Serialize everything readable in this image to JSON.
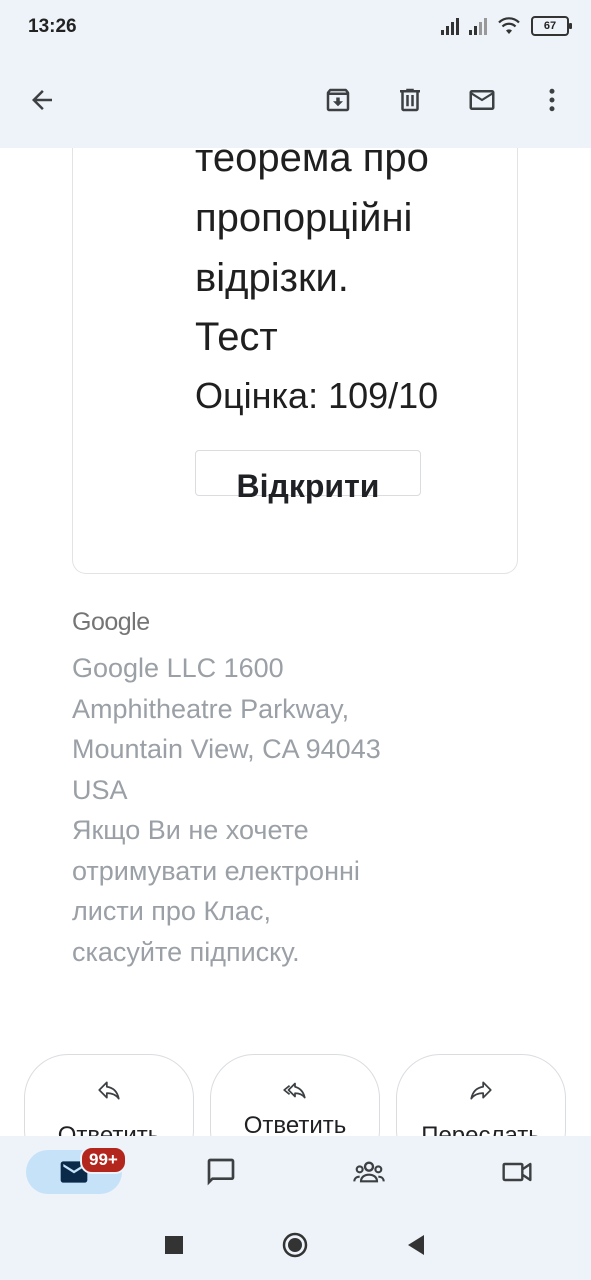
{
  "status_bar": {
    "time": "13:26",
    "battery": "67"
  },
  "toolbar": {
    "back_icon": "arrow-back-icon",
    "archive_icon": "archive-icon",
    "delete_icon": "trash-icon",
    "mark_unread_icon": "mail-icon",
    "more_icon": "more-vert-icon"
  },
  "card": {
    "title_lines": [
      "теорема про",
      "пропорційні",
      "відрізки.",
      "Тест"
    ],
    "grade": "Оцінка: 109/10",
    "open_button": "Відкрити"
  },
  "footer": {
    "logo": "Google",
    "lines": [
      "Google LLC 1600",
      "Amphitheatre Parkway,",
      "Mountain View, CA 94043",
      "USA",
      "Якщо Ви не хочете",
      "отримувати електронні",
      "листи про Клас,",
      "скасуйте підписку."
    ]
  },
  "reply_actions": {
    "reply": "Ответить",
    "reply_all": "Ответить",
    "forward": "Переслать"
  },
  "bottom_nav": {
    "mail_badge": "99+",
    "items": [
      "mail-icon",
      "chat-icon",
      "spaces-icon",
      "meet-icon"
    ]
  },
  "colors": {
    "bar_background": "#eef3f9",
    "active_pill": "#c6e2f8",
    "badge": "#b3261e",
    "footer_text": "#9aa0a6"
  }
}
